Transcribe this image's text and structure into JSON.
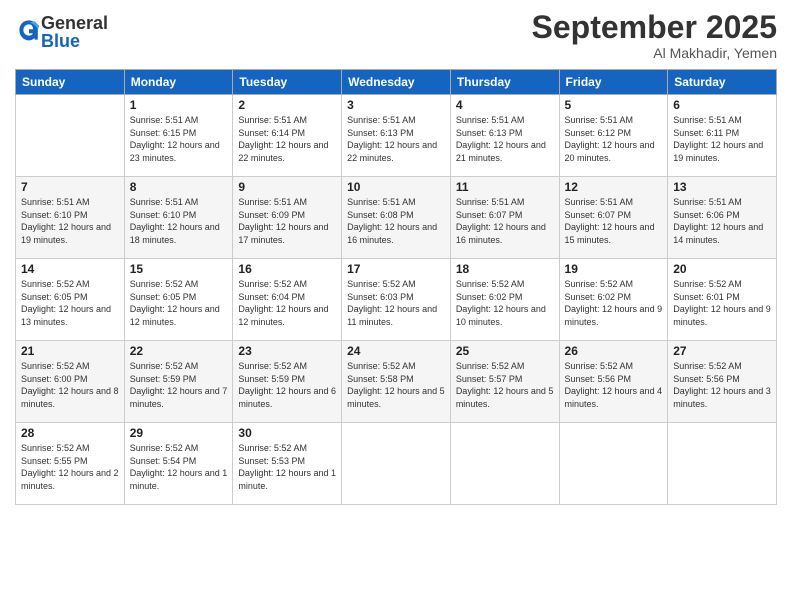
{
  "logo": {
    "general": "General",
    "blue": "Blue"
  },
  "header": {
    "month": "September 2025",
    "location": "Al Makhadir, Yemen"
  },
  "days_of_week": [
    "Sunday",
    "Monday",
    "Tuesday",
    "Wednesday",
    "Thursday",
    "Friday",
    "Saturday"
  ],
  "weeks": [
    [
      {
        "day": "",
        "sunrise": "",
        "sunset": "",
        "daylight": ""
      },
      {
        "day": "1",
        "sunrise": "Sunrise: 5:51 AM",
        "sunset": "Sunset: 6:15 PM",
        "daylight": "Daylight: 12 hours and 23 minutes."
      },
      {
        "day": "2",
        "sunrise": "Sunrise: 5:51 AM",
        "sunset": "Sunset: 6:14 PM",
        "daylight": "Daylight: 12 hours and 22 minutes."
      },
      {
        "day": "3",
        "sunrise": "Sunrise: 5:51 AM",
        "sunset": "Sunset: 6:13 PM",
        "daylight": "Daylight: 12 hours and 22 minutes."
      },
      {
        "day": "4",
        "sunrise": "Sunrise: 5:51 AM",
        "sunset": "Sunset: 6:13 PM",
        "daylight": "Daylight: 12 hours and 21 minutes."
      },
      {
        "day": "5",
        "sunrise": "Sunrise: 5:51 AM",
        "sunset": "Sunset: 6:12 PM",
        "daylight": "Daylight: 12 hours and 20 minutes."
      },
      {
        "day": "6",
        "sunrise": "Sunrise: 5:51 AM",
        "sunset": "Sunset: 6:11 PM",
        "daylight": "Daylight: 12 hours and 19 minutes."
      }
    ],
    [
      {
        "day": "7",
        "sunrise": "Sunrise: 5:51 AM",
        "sunset": "Sunset: 6:10 PM",
        "daylight": "Daylight: 12 hours and 19 minutes."
      },
      {
        "day": "8",
        "sunrise": "Sunrise: 5:51 AM",
        "sunset": "Sunset: 6:10 PM",
        "daylight": "Daylight: 12 hours and 18 minutes."
      },
      {
        "day": "9",
        "sunrise": "Sunrise: 5:51 AM",
        "sunset": "Sunset: 6:09 PM",
        "daylight": "Daylight: 12 hours and 17 minutes."
      },
      {
        "day": "10",
        "sunrise": "Sunrise: 5:51 AM",
        "sunset": "Sunset: 6:08 PM",
        "daylight": "Daylight: 12 hours and 16 minutes."
      },
      {
        "day": "11",
        "sunrise": "Sunrise: 5:51 AM",
        "sunset": "Sunset: 6:07 PM",
        "daylight": "Daylight: 12 hours and 16 minutes."
      },
      {
        "day": "12",
        "sunrise": "Sunrise: 5:51 AM",
        "sunset": "Sunset: 6:07 PM",
        "daylight": "Daylight: 12 hours and 15 minutes."
      },
      {
        "day": "13",
        "sunrise": "Sunrise: 5:51 AM",
        "sunset": "Sunset: 6:06 PM",
        "daylight": "Daylight: 12 hours and 14 minutes."
      }
    ],
    [
      {
        "day": "14",
        "sunrise": "Sunrise: 5:52 AM",
        "sunset": "Sunset: 6:05 PM",
        "daylight": "Daylight: 12 hours and 13 minutes."
      },
      {
        "day": "15",
        "sunrise": "Sunrise: 5:52 AM",
        "sunset": "Sunset: 6:05 PM",
        "daylight": "Daylight: 12 hours and 12 minutes."
      },
      {
        "day": "16",
        "sunrise": "Sunrise: 5:52 AM",
        "sunset": "Sunset: 6:04 PM",
        "daylight": "Daylight: 12 hours and 12 minutes."
      },
      {
        "day": "17",
        "sunrise": "Sunrise: 5:52 AM",
        "sunset": "Sunset: 6:03 PM",
        "daylight": "Daylight: 12 hours and 11 minutes."
      },
      {
        "day": "18",
        "sunrise": "Sunrise: 5:52 AM",
        "sunset": "Sunset: 6:02 PM",
        "daylight": "Daylight: 12 hours and 10 minutes."
      },
      {
        "day": "19",
        "sunrise": "Sunrise: 5:52 AM",
        "sunset": "Sunset: 6:02 PM",
        "daylight": "Daylight: 12 hours and 9 minutes."
      },
      {
        "day": "20",
        "sunrise": "Sunrise: 5:52 AM",
        "sunset": "Sunset: 6:01 PM",
        "daylight": "Daylight: 12 hours and 9 minutes."
      }
    ],
    [
      {
        "day": "21",
        "sunrise": "Sunrise: 5:52 AM",
        "sunset": "Sunset: 6:00 PM",
        "daylight": "Daylight: 12 hours and 8 minutes."
      },
      {
        "day": "22",
        "sunrise": "Sunrise: 5:52 AM",
        "sunset": "Sunset: 5:59 PM",
        "daylight": "Daylight: 12 hours and 7 minutes."
      },
      {
        "day": "23",
        "sunrise": "Sunrise: 5:52 AM",
        "sunset": "Sunset: 5:59 PM",
        "daylight": "Daylight: 12 hours and 6 minutes."
      },
      {
        "day": "24",
        "sunrise": "Sunrise: 5:52 AM",
        "sunset": "Sunset: 5:58 PM",
        "daylight": "Daylight: 12 hours and 5 minutes."
      },
      {
        "day": "25",
        "sunrise": "Sunrise: 5:52 AM",
        "sunset": "Sunset: 5:57 PM",
        "daylight": "Daylight: 12 hours and 5 minutes."
      },
      {
        "day": "26",
        "sunrise": "Sunrise: 5:52 AM",
        "sunset": "Sunset: 5:56 PM",
        "daylight": "Daylight: 12 hours and 4 minutes."
      },
      {
        "day": "27",
        "sunrise": "Sunrise: 5:52 AM",
        "sunset": "Sunset: 5:56 PM",
        "daylight": "Daylight: 12 hours and 3 minutes."
      }
    ],
    [
      {
        "day": "28",
        "sunrise": "Sunrise: 5:52 AM",
        "sunset": "Sunset: 5:55 PM",
        "daylight": "Daylight: 12 hours and 2 minutes."
      },
      {
        "day": "29",
        "sunrise": "Sunrise: 5:52 AM",
        "sunset": "Sunset: 5:54 PM",
        "daylight": "Daylight: 12 hours and 1 minute."
      },
      {
        "day": "30",
        "sunrise": "Sunrise: 5:52 AM",
        "sunset": "Sunset: 5:53 PM",
        "daylight": "Daylight: 12 hours and 1 minute."
      },
      {
        "day": "",
        "sunrise": "",
        "sunset": "",
        "daylight": ""
      },
      {
        "day": "",
        "sunrise": "",
        "sunset": "",
        "daylight": ""
      },
      {
        "day": "",
        "sunrise": "",
        "sunset": "",
        "daylight": ""
      },
      {
        "day": "",
        "sunrise": "",
        "sunset": "",
        "daylight": ""
      }
    ]
  ]
}
